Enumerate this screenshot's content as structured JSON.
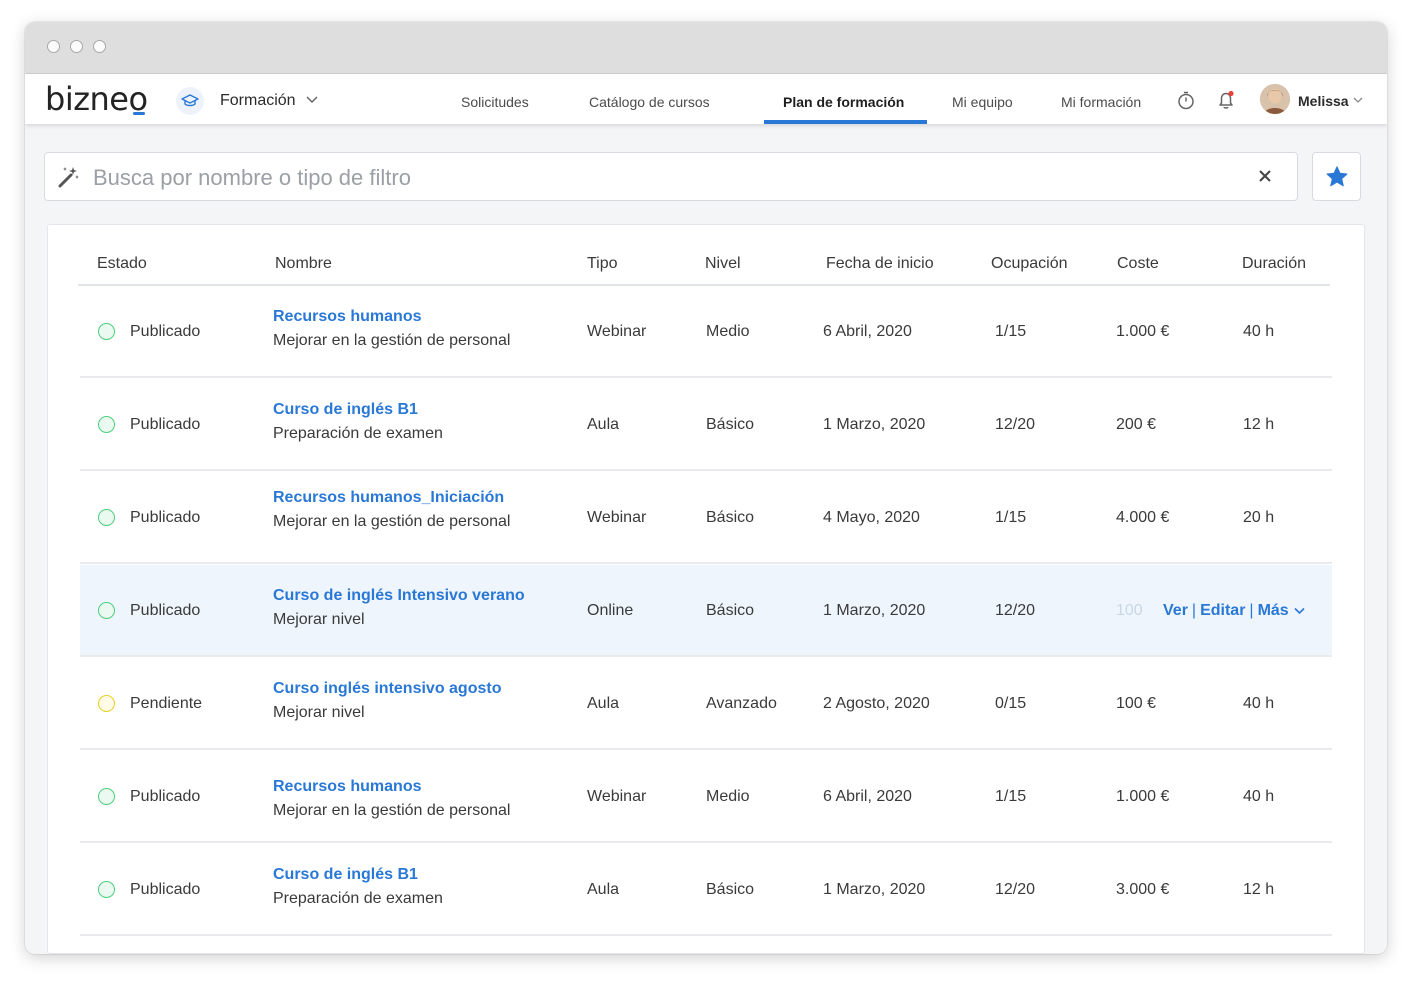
{
  "app": {
    "logo": "bizneo",
    "module": "Formación"
  },
  "nav": {
    "items": [
      {
        "label": "Solicitudes"
      },
      {
        "label": "Catálogo de cursos"
      },
      {
        "label": "Plan de formación",
        "active": true
      },
      {
        "label": "Mi equipo"
      },
      {
        "label": "Mi formación"
      }
    ]
  },
  "user": {
    "name": "Melissa"
  },
  "search": {
    "placeholder": "Busca por nombre o tipo de filtro",
    "value": ""
  },
  "table": {
    "headers": [
      "Estado",
      "Nombre",
      "Tipo",
      "Nivel",
      "Fecha de inicio",
      "Ocupación",
      "Coste",
      "Duración"
    ],
    "rows": [
      {
        "status": "Publicado",
        "status_type": "published",
        "name": "Recursos humanos",
        "description": "Mejorar en la gestión de personal",
        "type": "Webinar",
        "level": "Medio",
        "start": "6 Abril, 2020",
        "occupancy": "1/15",
        "cost": "1.000 €",
        "duration": "40 h"
      },
      {
        "status": "Publicado",
        "status_type": "published",
        "name": "Curso de inglés B1",
        "description": "Preparación de examen",
        "type": "Aula",
        "level": "Básico",
        "start": "1 Marzo, 2020",
        "occupancy": "12/20",
        "cost": "200 €",
        "duration": "12 h"
      },
      {
        "status": "Publicado",
        "status_type": "published",
        "name": "Recursos humanos_Iniciación",
        "description": "Mejorar en la gestión de personal",
        "type": "Webinar",
        "level": "Básico",
        "start": "4 Mayo, 2020",
        "occupancy": "1/15",
        "cost": "4.000 €",
        "duration": "20 h"
      },
      {
        "status": "Publicado",
        "status_type": "published",
        "name": "Curso de inglés Intensivo verano",
        "description": "Mejorar nivel",
        "type": "Online",
        "level": "Básico",
        "start": "1 Marzo, 2020",
        "occupancy": "12/20",
        "cost": "100",
        "duration": "",
        "hovered": true
      },
      {
        "status": "Pendiente",
        "status_type": "pending",
        "name": "Curso inglés intensivo agosto",
        "description": "Mejorar nivel",
        "type": "Aula",
        "level": "Avanzado",
        "start": "2 Agosto, 2020",
        "occupancy": "0/15",
        "cost": "100 €",
        "duration": "40 h"
      },
      {
        "status": "Publicado",
        "status_type": "published",
        "name": "Recursos humanos",
        "description": "Mejorar en la gestión de personal",
        "type": "Webinar",
        "level": "Medio",
        "start": "6 Abril, 2020",
        "occupancy": "1/15",
        "cost": "1.000 €",
        "duration": "40 h"
      },
      {
        "status": "Publicado",
        "status_type": "published",
        "name": "Curso de inglés B1",
        "description": "Preparación de examen",
        "type": "Aula",
        "level": "Básico",
        "start": "1 Marzo, 2020",
        "occupancy": "12/20",
        "cost": "3.000 €",
        "duration": "12 h"
      }
    ]
  },
  "row_actions": {
    "view": "Ver",
    "edit": "Editar",
    "more": "Más",
    "separator": "|"
  },
  "colors": {
    "accent": "#2a78d6",
    "published": "#4bcf7a",
    "pending": "#e6d023",
    "hover_row": "#eef5fd"
  }
}
